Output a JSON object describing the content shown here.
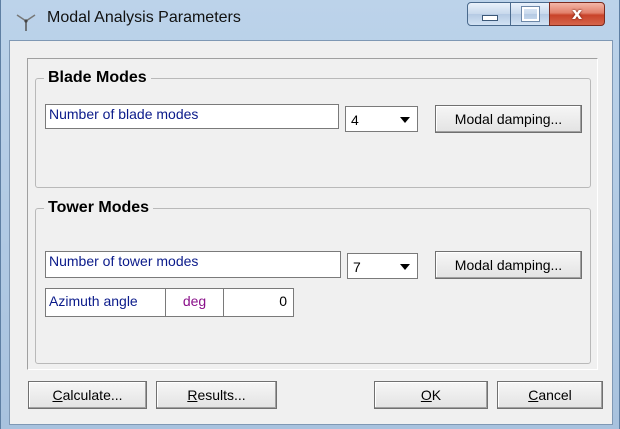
{
  "window": {
    "title": "Modal Analysis Parameters",
    "close_symbol": "x",
    "accent": "#0a1a8a",
    "azimuth_unit_color": "#8a108a"
  },
  "blade": {
    "group_title": "Blade Modes",
    "label": "Number of blade modes",
    "value": "4",
    "damping_button": "Modal damping..."
  },
  "tower": {
    "group_title": "Tower Modes",
    "label": "Number of tower modes",
    "value": "7",
    "damping_button": "Modal damping...",
    "azimuth_label": "Azimuth angle",
    "azimuth_unit": "deg",
    "azimuth_value": "0"
  },
  "buttons": {
    "calculate_first": "C",
    "calculate_rest": "alculate...",
    "results_first": "R",
    "results_rest": "esults...",
    "ok_first": "O",
    "ok_rest": "K",
    "cancel_first": "C",
    "cancel_rest": "ancel"
  }
}
